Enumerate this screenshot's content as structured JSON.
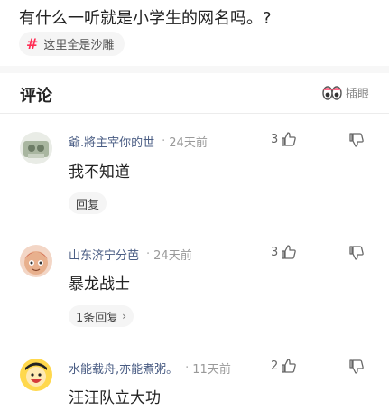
{
  "post": {
    "title": "有什么一听就是小学生的网名吗。?",
    "topic": "这里全是沙雕"
  },
  "comments_header": {
    "title": "评论",
    "insert_label": "插眼"
  },
  "comments": [
    {
      "author": "爺.將主宰你的世",
      "time": "24天前",
      "text": "我不知道",
      "likes": "3",
      "reply_label": "回复",
      "reply_chevron": ""
    },
    {
      "author": "山东济宁分芭",
      "time": "24天前",
      "text": "暴龙战士",
      "likes": "3",
      "reply_label": "1条回复",
      "reply_chevron": "›"
    },
    {
      "author": "水能载舟,亦能煮粥。",
      "time": "11天前",
      "text": "汪汪队立大功",
      "likes": "2",
      "reply_label": "",
      "reply_chevron": ""
    }
  ],
  "icons": {
    "topic": "hashtag-icon",
    "insert": "eyes-icon",
    "like": "thumb-up-icon",
    "dislike": "thumb-down-icon"
  },
  "colors": {
    "author": "#4a5d84",
    "hashtag": "#ff2d55",
    "time": "#999999"
  }
}
